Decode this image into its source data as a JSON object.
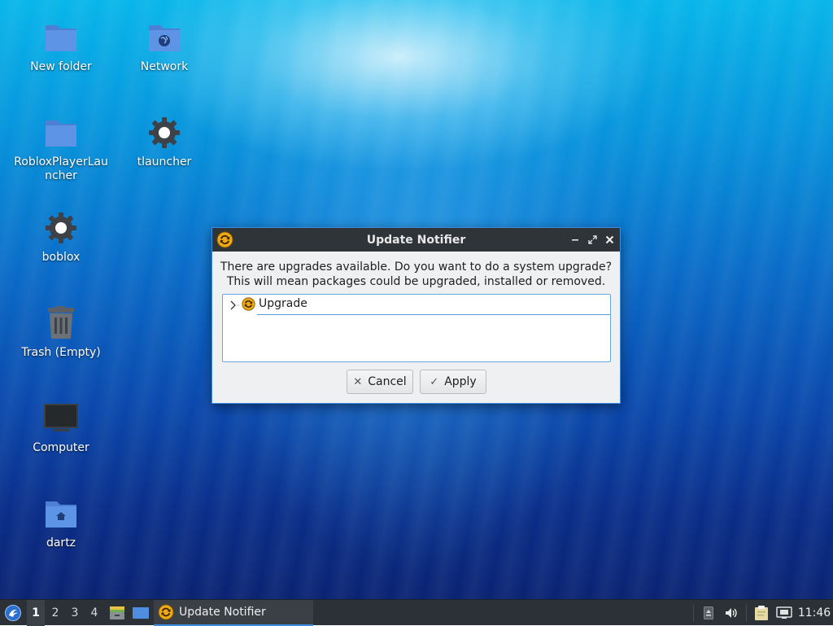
{
  "desktop": {
    "icons": [
      {
        "label": "New folder"
      },
      {
        "label": "Network"
      },
      {
        "label": "RobloxPlayerLauncher"
      },
      {
        "label": "tlauncher"
      },
      {
        "label": "boblox"
      },
      {
        "label": "Trash (Empty)"
      },
      {
        "label": "Computer"
      },
      {
        "label": "dartz"
      }
    ]
  },
  "dialog": {
    "title": "Update Notifier",
    "message_line1": "There are upgrades available. Do you want to do a system upgrade?",
    "message_line2": "This will mean packages could be upgraded, installed or removed.",
    "tree_item": "Upgrade",
    "cancel_label": "Cancel",
    "apply_label": "Apply"
  },
  "taskbar": {
    "workspaces": [
      "1",
      "2",
      "3",
      "4"
    ],
    "active_workspace": "1",
    "task_label": "Update Notifier",
    "clock": "11:46"
  },
  "colors": {
    "accent": "#3d8ee0",
    "folder": "#5b8fe0",
    "titlebar": "#2f3439",
    "taskbar": "#2b3136"
  }
}
